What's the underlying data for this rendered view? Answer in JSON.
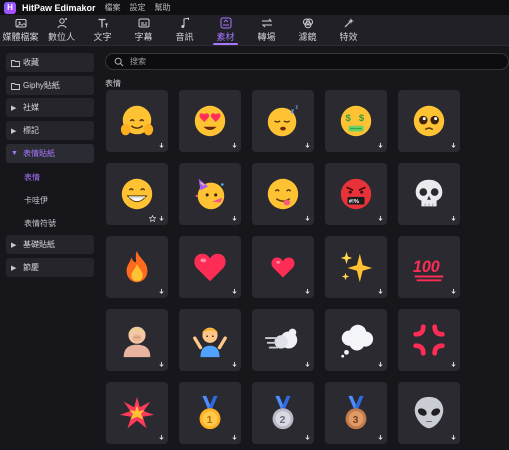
{
  "app": {
    "title": "HitPaw Edimakor",
    "menu": [
      "檔案",
      "設定",
      "幫助"
    ]
  },
  "toolbar": {
    "items": [
      {
        "label": "媒體檔案",
        "icon": "media-folder-icon"
      },
      {
        "label": "數位人",
        "icon": "digital-human-icon"
      },
      {
        "label": "文字",
        "icon": "text-icon"
      },
      {
        "label": "字幕",
        "icon": "subtitle-icon"
      },
      {
        "label": "音訊",
        "icon": "music-note-icon"
      },
      {
        "label": "素材",
        "icon": "assets-icon",
        "active": true
      },
      {
        "label": "轉場",
        "icon": "transition-icon"
      },
      {
        "label": "濾鏡",
        "icon": "filter-icon"
      },
      {
        "label": "特效",
        "icon": "effects-icon"
      }
    ],
    "accent": "#a678ff"
  },
  "sidebar": {
    "favorites": "收藏",
    "giphy": "Giphy貼紙",
    "social": "社媒",
    "tags": "標記",
    "emoji_stickers": "表情貼紙",
    "sub": [
      "表情",
      "卡哇伊",
      "表情符號"
    ],
    "basic_stickers": "基礎貼紙",
    "holiday": "節慶"
  },
  "search": {
    "placeholder": "搜索"
  },
  "section": {
    "title": "表情"
  },
  "grid": {
    "rows": [
      [
        "hugging-face",
        "heart-eyes-face",
        "sleeping-face",
        "money-mouth-face",
        "pleading-face"
      ],
      [
        "grinning-face",
        "party-face",
        "yum-face",
        "cursing-face",
        "skull"
      ],
      [
        "fire",
        "red-heart",
        "small-heart",
        "sparkles",
        "hundred-points"
      ],
      [
        "person-facepalming",
        "person-shrugging",
        "dashing-away",
        "speech-balloon",
        "anger-symbol"
      ],
      [
        "collision",
        "first-place-medal",
        "second-place-medal",
        "third-place-medal",
        "alien"
      ]
    ],
    "medal_numbers": [
      "1",
      "2",
      "3"
    ],
    "hundred_text": "100"
  }
}
